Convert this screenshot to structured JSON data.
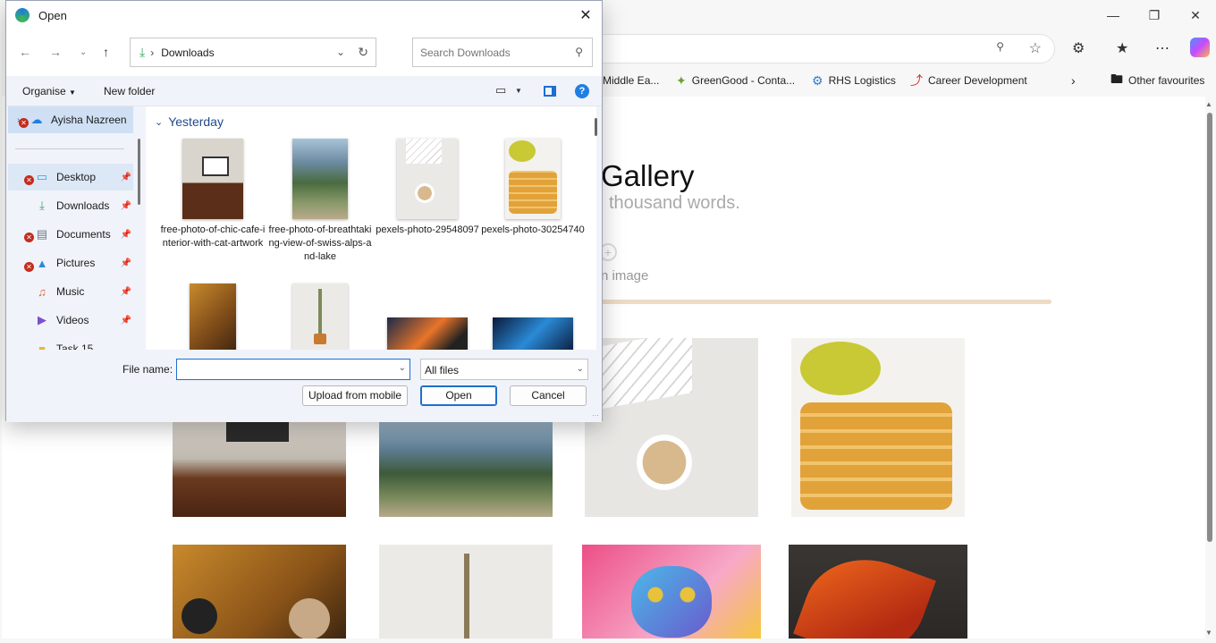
{
  "browser": {
    "bookmarks": [
      {
        "label": "Middle Ea...",
        "icon": "globe-icon"
      },
      {
        "label": "GreenGood - Conta...",
        "icon": "leaf-icon"
      },
      {
        "label": "RHS Logistics",
        "icon": "gear-icon"
      },
      {
        "label": "Career Development",
        "icon": "arrow-icon"
      },
      {
        "label": "Other favourites",
        "icon": "folder-icon"
      }
    ],
    "page": {
      "title": "Gallery",
      "subtitle": "thousand words.",
      "upload_text": "n image",
      "progress_fraction": 1.0
    },
    "colors": {
      "accent": "#eedbc6"
    }
  },
  "dialog": {
    "title": "Open",
    "path": "Downloads",
    "search_placeholder": "Search Downloads",
    "commands": {
      "organise": "Organise",
      "new_folder": "New folder"
    },
    "nav_items": [
      {
        "label": "Ayisha Nazreen",
        "icon": "cloud-icon",
        "error": true,
        "pinned": false
      },
      {
        "label": "Desktop",
        "icon": "desktop-icon",
        "error": true,
        "pinned": true
      },
      {
        "label": "Downloads",
        "icon": "download-icon",
        "error": false,
        "pinned": true
      },
      {
        "label": "Documents",
        "icon": "document-icon",
        "error": true,
        "pinned": true
      },
      {
        "label": "Pictures",
        "icon": "pictures-icon",
        "error": true,
        "pinned": true
      },
      {
        "label": "Music",
        "icon": "music-icon",
        "error": false,
        "pinned": true
      },
      {
        "label": "Videos",
        "icon": "video-icon",
        "error": false,
        "pinned": true
      },
      {
        "label": "Task 15",
        "icon": "folder-icon",
        "error": false,
        "pinned": false
      }
    ],
    "group_label": "Yesterday",
    "files": [
      {
        "name": "free-photo-of-chic-cafe-interior-with-cat-artwork"
      },
      {
        "name": "free-photo-of-breathtaking-view-of-swiss-alps-and-lake"
      },
      {
        "name": "pexels-photo-29548097"
      },
      {
        "name": "pexels-photo-30254740"
      },
      {
        "name": ""
      },
      {
        "name": ""
      },
      {
        "name": ""
      },
      {
        "name": ""
      }
    ],
    "file_name_label": "File name:",
    "file_name_value": "",
    "file_type": "All files",
    "buttons": {
      "upload": "Upload from mobile",
      "open": "Open",
      "cancel": "Cancel"
    }
  }
}
